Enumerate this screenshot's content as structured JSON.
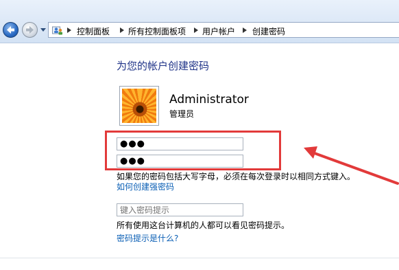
{
  "window": {
    "breadcrumb": [
      "控制面板",
      "所有控制面板项",
      "用户帐户",
      "创建密码"
    ]
  },
  "page": {
    "title": "为您的帐户创建密码",
    "user": {
      "name": "Administrator",
      "role": "管理员"
    },
    "new_password": {
      "value": "●●●"
    },
    "confirm_password": {
      "value": "●●●"
    },
    "case_note": "如果您的密码包括大写字母，必须在每次登录时以相同方式键入。",
    "strong_password_link": "如何创建强密码",
    "hint_field": {
      "placeholder": "键入密码提示"
    },
    "hint_visibility_note": "所有使用这台计算机的人都可以看见密码提示。",
    "hint_help_link": "密码提示是什么?"
  },
  "icons": {
    "back": "back-arrow-icon",
    "forward": "forward-arrow-icon",
    "history": "chevron-down-icon",
    "control_panel": "users-control-panel-icon",
    "avatar": "flower-avatar-image",
    "breadcrumb_separator": "triangle-right-icon"
  },
  "colors": {
    "title": "#1e3287",
    "link": "#0b5fb5",
    "annotation": "#e23a3a"
  }
}
